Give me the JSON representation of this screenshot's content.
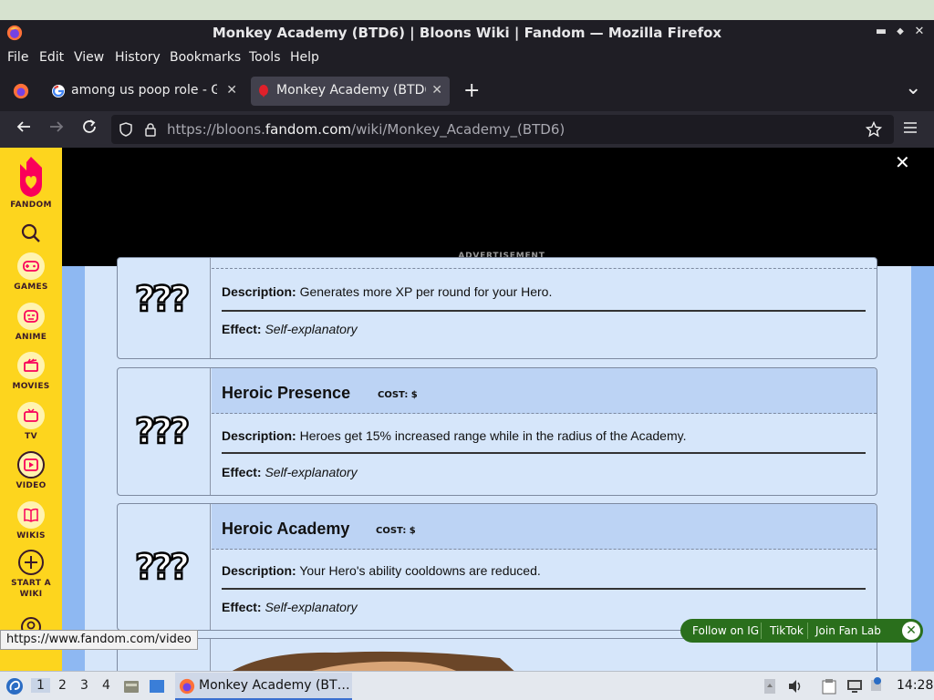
{
  "window": {
    "title": "Monkey Academy (BTD6) | Bloons Wiki | Fandom — Mozilla Firefox",
    "minimize": "▬",
    "restore": "◆",
    "close": "✕"
  },
  "menu": [
    "File",
    "Edit",
    "View",
    "History",
    "Bookmarks",
    "Tools",
    "Help"
  ],
  "tabs": [
    {
      "label": "among us poop role - Go",
      "close": "✕"
    },
    {
      "label": "Monkey Academy (BTD6",
      "close": "✕"
    }
  ],
  "new_tab": "+",
  "tab_list": "⌄",
  "nav": {
    "url_prefix": "https://bloons.",
    "url_domain": "fandom.com",
    "url_suffix": "/wiki/Monkey_Academy_(BTD6)"
  },
  "rail": {
    "logo_label": "FANDOM",
    "items": [
      "GAMES",
      "ANIME",
      "MOVIES",
      "TV",
      "VIDEO",
      "WIKIS",
      "START A WIKI"
    ]
  },
  "ad": {
    "label": "ADVERTISEMENT",
    "close": "✕"
  },
  "cards": [
    {
      "name": "",
      "cost": "",
      "desc_label": "Description:",
      "desc": " Generates more XP per round for your Hero.",
      "eff_label": "Effect:",
      "eff": " Self-explanatory"
    },
    {
      "name": "Heroic Presence",
      "cost": "COST: $",
      "desc_label": "Description:",
      "desc": " Heroes get 15% increased range while in the radius of the Academy.",
      "eff_label": "Effect:",
      "eff": " Self-explanatory"
    },
    {
      "name": "Heroic Academy",
      "cost": "COST: $",
      "desc_label": "Description:",
      "desc": " Your Hero's ability cooldowns are reduced.",
      "eff_label": "Effect:",
      "eff": " Self-explanatory"
    }
  ],
  "social": {
    "ig": "Follow on IG",
    "tiktok": "TikTok",
    "fanlab": "Join Fan Lab",
    "close": "✕"
  },
  "status_url": "https://www.fandom.com/video",
  "taskbar": {
    "workspaces": [
      "1",
      "2",
      "3",
      "4"
    ],
    "task_label": "Monkey Academy (BT…",
    "clock": "14:28"
  },
  "colors": {
    "fandom_yellow": "#fdd51e",
    "fandom_pink": "#fa005a",
    "page_blue": "#8eb8f2"
  }
}
